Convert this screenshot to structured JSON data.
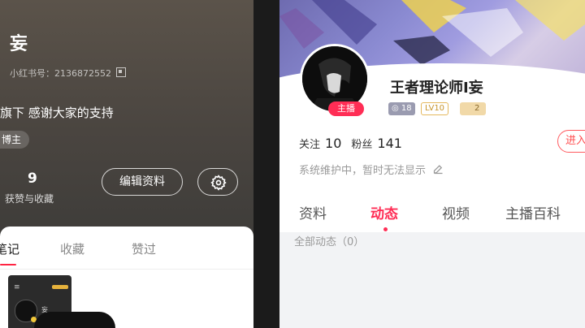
{
  "left_profile": {
    "name": "妄",
    "redbook_id": "小红书号：2136872552",
    "bio": "旗下 感谢大家的支持",
    "tag": "博主",
    "likes_count": "9",
    "likes_label": "获赞与收藏",
    "edit_button": "编辑资料",
    "tabs": [
      "笔记",
      "收藏",
      "赞过"
    ],
    "note_thumb_name": "妄"
  },
  "right_profile": {
    "username": "王者理论师I妄",
    "live_badge": "主播",
    "badge_level_1": "18",
    "badge_level_2": "LV10",
    "badge_level_3": "2",
    "follow_label": "关注",
    "follow_count": "10",
    "fans_label": "粉丝",
    "fans_count": "141",
    "enter_button": "进入",
    "status_text": "系统维护中，暂时无法显示",
    "tabs": [
      "资料",
      "动态",
      "视频",
      "主播百科"
    ],
    "active_tab": "动态",
    "all_dynamics": "全部动态（0）"
  },
  "colors": {
    "accent_red": "#ff2d55",
    "note_underline": "#ff2442",
    "gold": "#e5b95f"
  },
  "icons": {
    "qr": "qr-code-icon",
    "gear": "gear-icon",
    "pencil": "pencil-icon",
    "menu": "menu-icon"
  }
}
